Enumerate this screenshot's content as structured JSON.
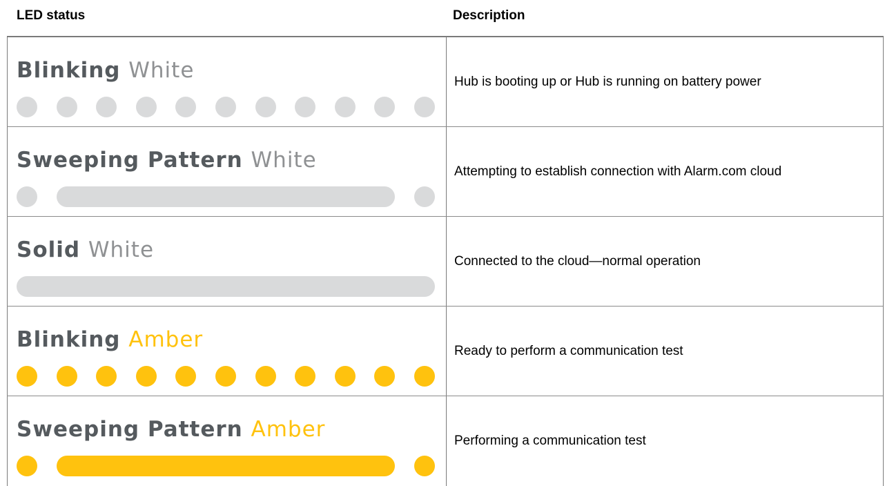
{
  "header": {
    "led_status": "LED status",
    "description": "Description"
  },
  "colors": {
    "led_white": "#d9dadb",
    "led_amber": "#ffc20e",
    "title_dark": "#555a5e",
    "title_white_word": "#8f9193",
    "border": "#7a7a7a"
  },
  "rows": [
    {
      "pattern": "Blinking",
      "color_word": "White",
      "color": "white",
      "strip": "dots",
      "description": "Hub is booting up or Hub is running on battery power"
    },
    {
      "pattern": "Sweeping Pattern",
      "color_word": "White",
      "color": "white",
      "strip": "sweep",
      "description": "Attempting to establish connection with Alarm.com cloud"
    },
    {
      "pattern": "Solid",
      "color_word": "White",
      "color": "white",
      "strip": "solid",
      "description": "Connected to the cloud—normal operation"
    },
    {
      "pattern": "Blinking",
      "color_word": "Amber",
      "color": "amber",
      "strip": "dots",
      "description": "Ready to perform a communication test"
    },
    {
      "pattern": "Sweeping Pattern",
      "color_word": "Amber",
      "color": "amber",
      "strip": "sweep",
      "description": "Performing a communication test"
    }
  ]
}
